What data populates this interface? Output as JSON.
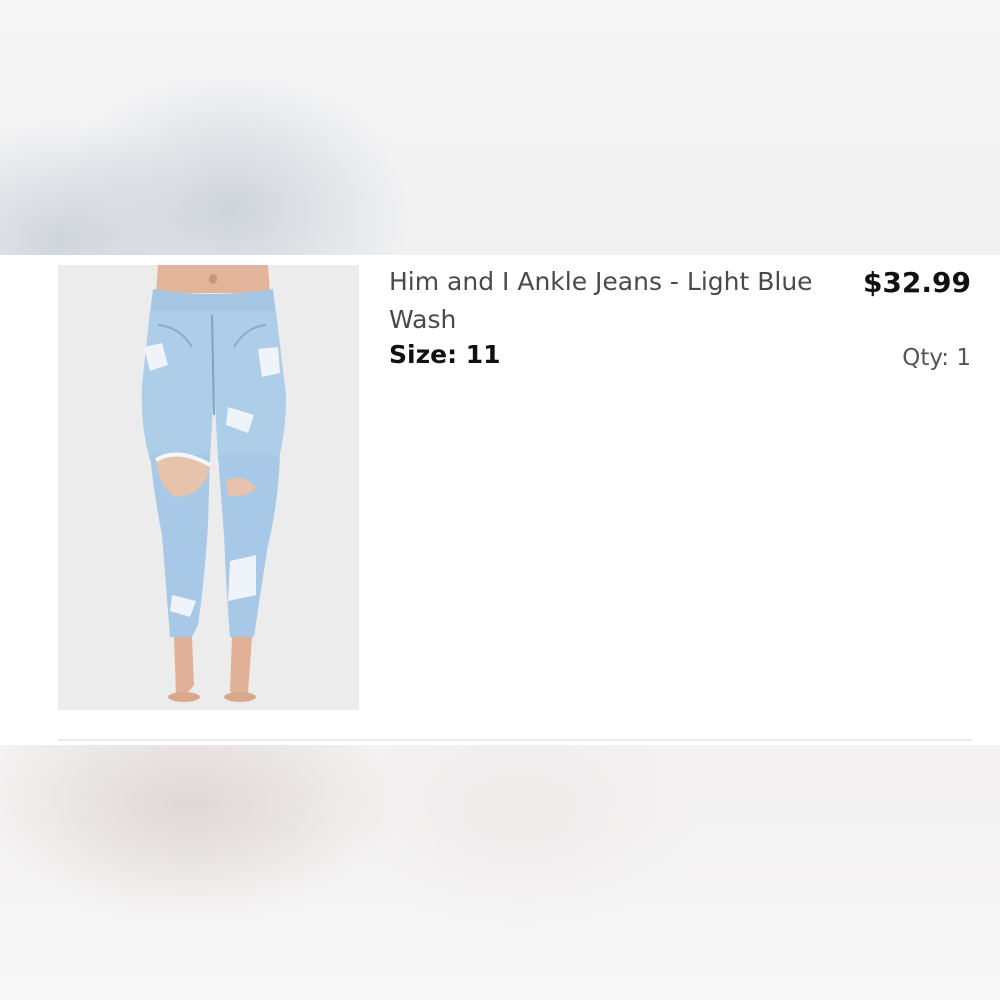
{
  "cart_item": {
    "title": "Him and I Ankle Jeans - Light Blue Wash",
    "size_label": "Size: 11",
    "price": "$32.99",
    "quantity_label": "Qty: 1",
    "image_icon": "jeans-product-photo"
  },
  "colors": {
    "card_background": "#ffffff",
    "title_text": "#4a4a4a",
    "price_text": "#111111",
    "qty_text": "#555555",
    "denim": "#a9c9e6",
    "divider": "#ebebeb"
  }
}
